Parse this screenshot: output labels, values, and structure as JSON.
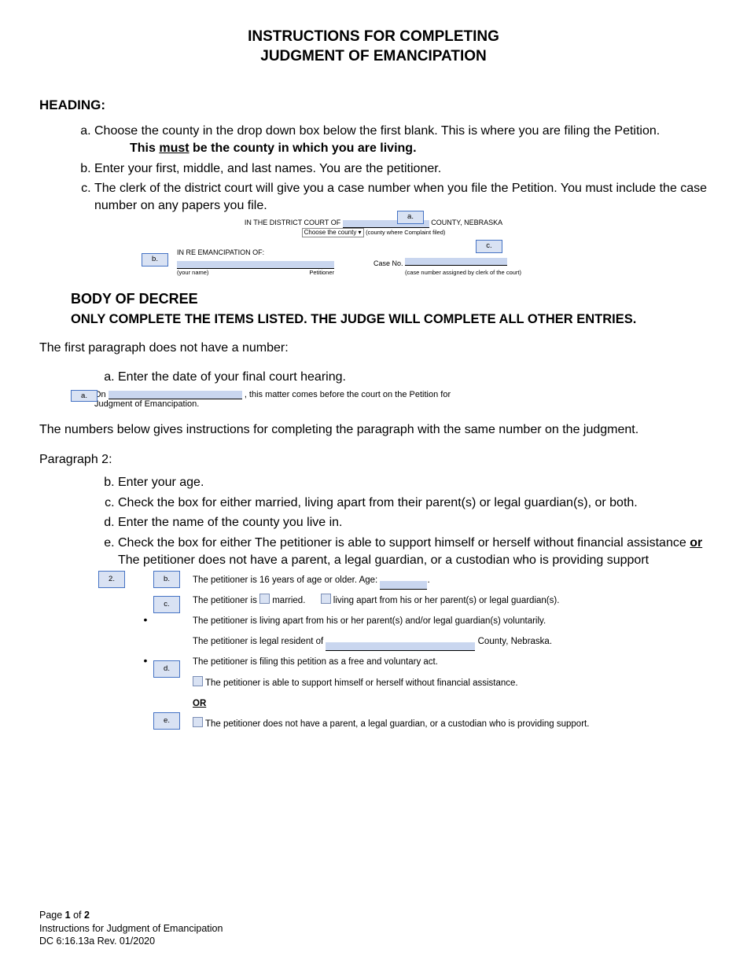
{
  "title_line1": "INSTRUCTIONS FOR COMPLETING",
  "title_line2": "JUDGMENT OF EMANCIPATION",
  "heading_section": "HEADING:",
  "heading_items": {
    "a": "Choose the county in the drop down box below the first blank. This is where you are filing the Petition.",
    "a_sub_prefix": "This ",
    "a_sub_underlined": "must",
    "a_sub_suffix": " be the county in which you are living.",
    "b": "Enter your first, middle, and last names. You are the petitioner.",
    "c": "The clerk of the district court will give you a case number when you file the Petition. You must include the case number on any papers you file."
  },
  "callout_labels": {
    "a": "a.",
    "b": "b.",
    "c": "c.",
    "d": "d.",
    "e": "e.",
    "two": "2."
  },
  "heading_form": {
    "left": "IN THE  DISTRICT COURT OF",
    "right": "COUNTY, NEBRASKA",
    "select": "Choose the county",
    "select_note": "(county where Complaint filed)",
    "inre": "IN RE EMANCIPATION OF:",
    "your_name": "(your name)",
    "petitioner": "Petitioner",
    "case_no": "Case No.",
    "case_note": "(case number assigned by clerk of the court)"
  },
  "body_heading": "BODY OF DECREE",
  "body_sub": "ONLY COMPLETE THE ITEMS LISTED. THE JUDGE WILL COMPLETE ALL OTHER ENTRIES.",
  "first_para_intro": "The first paragraph does not have a number:",
  "first_para_a": "Enter the date of your final court hearing.",
  "excerpt_a": {
    "on": "On",
    "after_blank": ", this matter comes before the court on the Petition for",
    "line2": "Judgment of Emancipation."
  },
  "numbers_intro": "The numbers below gives instructions for completing the paragraph with the same number on the judgment.",
  "para2_label": "Paragraph 2:",
  "para2_items": {
    "b": "Enter your age.",
    "c": "Check the box for either married, living apart from their parent(s) or legal guardian(s), or both.",
    "d": "Enter the name of the county you live in.",
    "e_prefix": "Check the box for either The petitioner is able to support himself or herself without financial assistance ",
    "e_underlined": "or",
    "e_suffix": " The petitioner does not have a parent, a legal guardian, or a custodian who is providing support"
  },
  "excerpt2": {
    "age_prefix": "The petitioner is 16 years of age or older.  Age:",
    "age_suffix": ".",
    "married_prefix": "The petitioner is ",
    "married": "married.",
    "living_apart": "living apart from his or her parent(s) or legal guardian(s).",
    "voluntarily": "The petitioner is living apart from his or her parent(s) and/or legal guardian(s) voluntarily.",
    "resident_prefix": "The petitioner is legal resident of",
    "resident_suffix": " County, Nebraska.",
    "free_act": "The petitioner is filing this petition as a free and voluntary act.",
    "support_self": "The petitioner is able to support himself or herself without financial assistance.",
    "or": "OR",
    "no_parent": "The petitioner does not have a parent, a legal guardian, or a custodian who is providing support."
  },
  "footer": {
    "page_prefix": "Page ",
    "page_num": "1",
    "of": " of ",
    "total": "2",
    "line2": "Instructions for Judgment of Emancipation",
    "line3": "DC 6:16.13a Rev. 01/2020"
  }
}
